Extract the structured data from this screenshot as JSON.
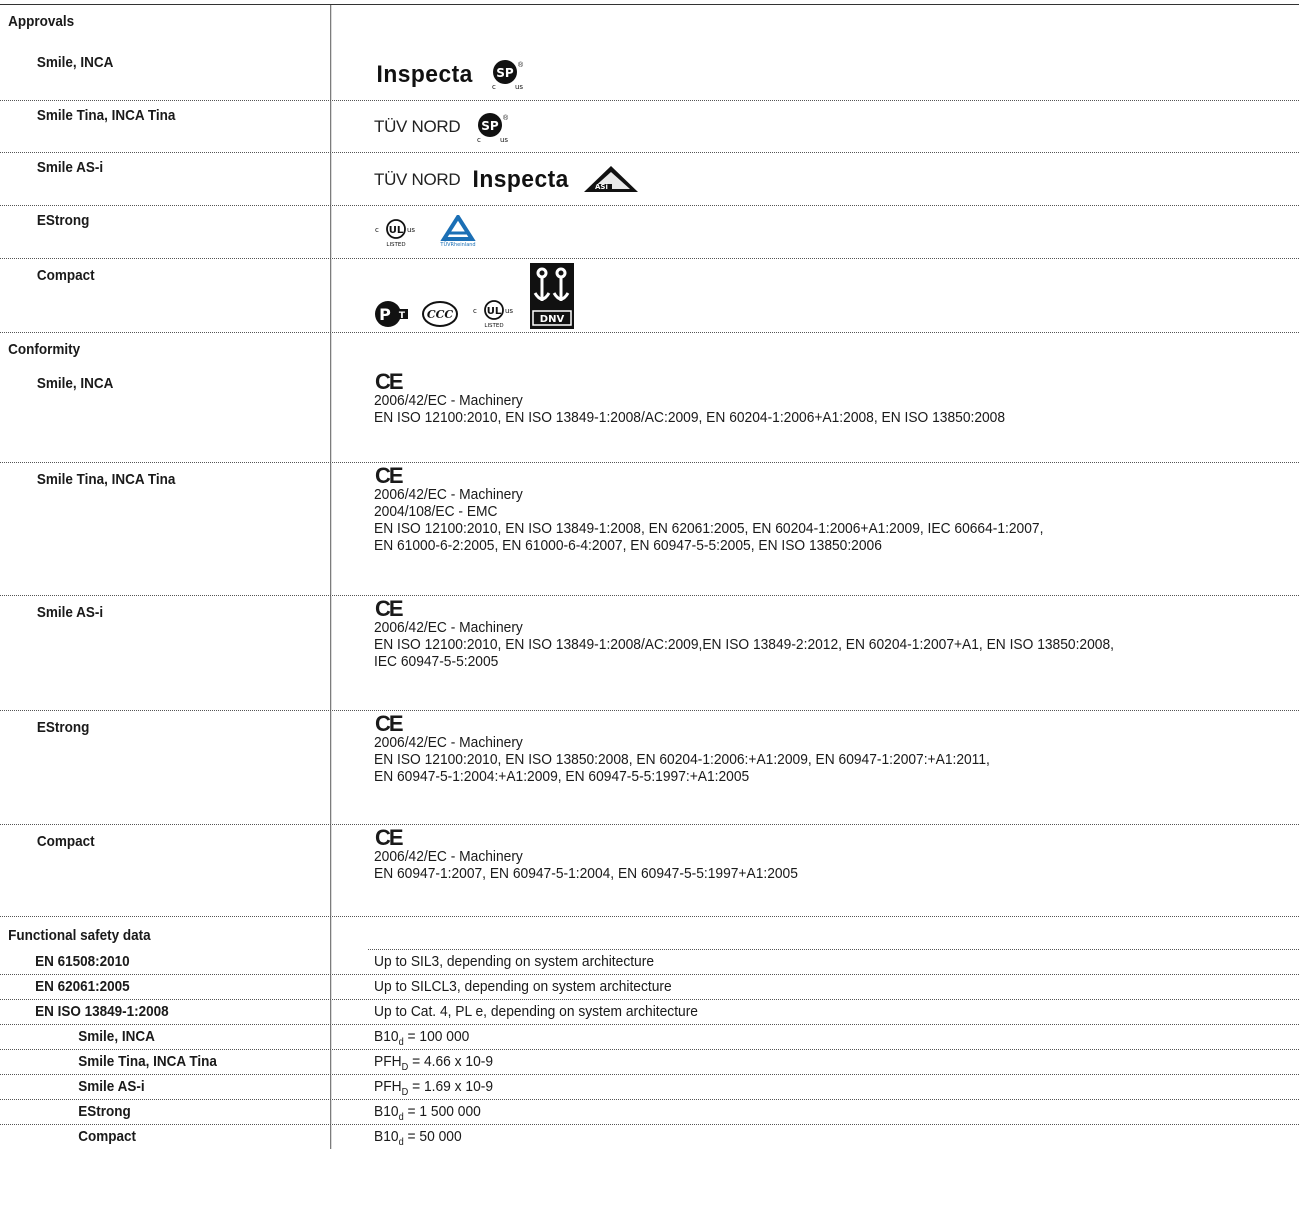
{
  "approvals": {
    "heading": "Approvals",
    "rows": [
      {
        "label": "Smile, INCA",
        "texts": [
          "Inspecta"
        ],
        "marks": [
          "csa-us-mark"
        ]
      },
      {
        "label": "Smile Tina, INCA Tina",
        "texts": [
          "TÜV NORD"
        ],
        "marks": [
          "csa-us-mark"
        ]
      },
      {
        "label": "Smile AS-i",
        "texts": [
          "TÜV NORD",
          "Inspecta"
        ],
        "marks": [
          "asi-mark"
        ]
      },
      {
        "label": "EStrong",
        "texts": [],
        "marks": [
          "ul-listed-mark",
          "tuv-rheinland-mark"
        ]
      },
      {
        "label": "Compact",
        "texts": [],
        "marks": [
          "gost-r-mark",
          "ccc-mark",
          "ul-listed-mark",
          "dnv-mark"
        ]
      }
    ]
  },
  "conformity": {
    "heading": "Conformity",
    "ce": "CE",
    "rows": [
      {
        "label": "Smile, INCA",
        "lines": [
          "2006/42/EC - Machinery",
          "EN ISO 12100:2010, EN ISO 13849-1:2008/AC:2009, EN 60204-1:2006+A1:2008, EN ISO 13850:2008"
        ]
      },
      {
        "label": "Smile Tina, INCA Tina",
        "lines": [
          "2006/42/EC - Machinery",
          "2004/108/EC - EMC",
          "EN ISO 12100:2010, EN ISO 13849-1:2008, EN 62061:2005, EN 60204-1:2006+A1:2009, IEC 60664-1:2007,",
          "EN 61000-6-2:2005, EN 61000-6-4:2007, EN 60947-5-5:2005, EN ISO 13850:2006"
        ]
      },
      {
        "label": "Smile AS-i",
        "lines": [
          "2006/42/EC - Machinery",
          "EN ISO 12100:2010, EN ISO 13849-1:2008/AC:2009,EN ISO 13849-2:2012, EN 60204-1:2007+A1, EN ISO 13850:2008,",
          "IEC 60947-5-5:2005"
        ]
      },
      {
        "label": "EStrong",
        "lines": [
          "2006/42/EC - Machinery",
          "EN ISO 12100:2010, EN ISO 13850:2008, EN 60204-1:2006:+A1:2009, EN 60947-1:2007:+A1:2011,",
          "EN 60947-5-1:2004:+A1:2009, EN 60947-5-5:1997:+A1:2005"
        ]
      },
      {
        "label": "Compact",
        "lines": [
          "2006/42/EC - Machinery",
          "EN 60947-1:2007, EN 60947-5-1:2004, EN 60947-5-5:1997+A1:2005"
        ]
      }
    ]
  },
  "functional_safety": {
    "heading": "Functional safety data",
    "standards": [
      {
        "label": "EN 61508:2010",
        "value": "Up to SIL3, depending on system architecture"
      },
      {
        "label": "EN 62061:2005",
        "value": "Up to SILCL3, depending on system architecture"
      },
      {
        "label": "EN ISO 13849-1:2008",
        "value": "Up to Cat. 4, PL e, depending on system architecture"
      }
    ],
    "products": [
      {
        "label": "Smile, INCA",
        "symbol": "B10",
        "sub": "d",
        "value": " = 100 000"
      },
      {
        "label": "Smile Tina, INCA Tina",
        "symbol": "PFH",
        "sub": "D",
        "value": " = 4.66 x 10-9"
      },
      {
        "label": "Smile AS-i",
        "symbol": "PFH",
        "sub": "D",
        "value": " = 1.69 x 10-9"
      },
      {
        "label": "EStrong",
        "symbol": "B10",
        "sub": "d",
        "value": " = 1 500 000"
      },
      {
        "label": "Compact",
        "symbol": "B10",
        "sub": "d",
        "value": " = 50 000"
      }
    ]
  }
}
